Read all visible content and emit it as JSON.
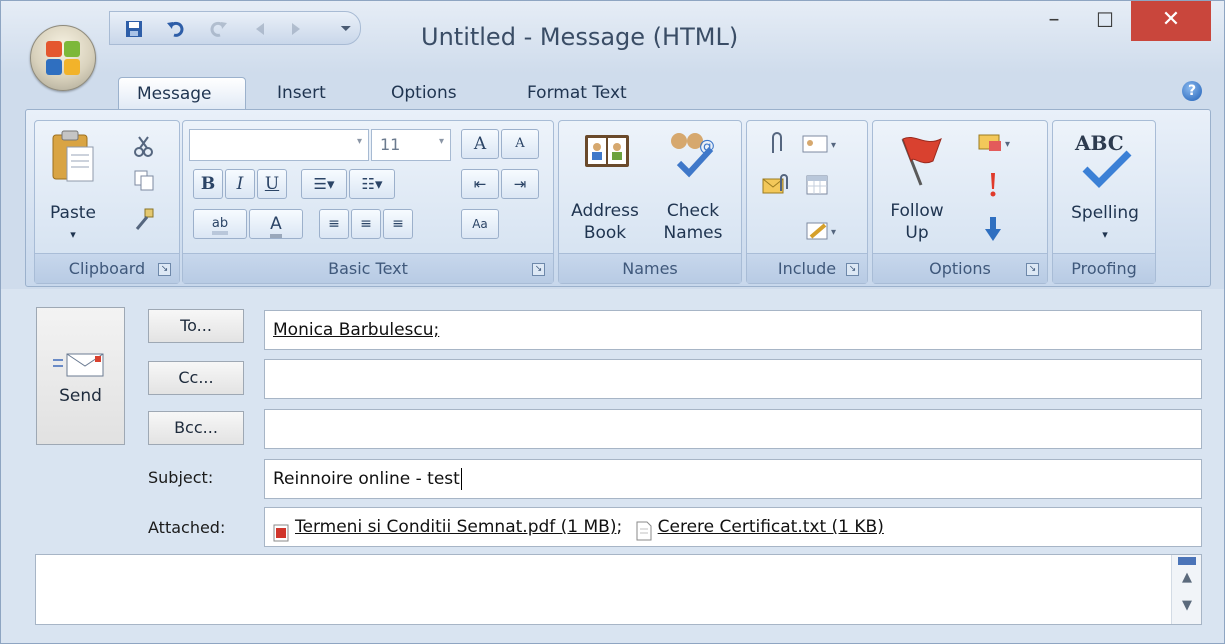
{
  "window": {
    "title": "Untitled - Message (HTML)",
    "controls": {
      "minimize": "–",
      "maximize": "☐",
      "close": "✕"
    }
  },
  "qat": {
    "items": [
      "save-icon",
      "undo-icon",
      "redo-icon",
      "previous-icon",
      "next-icon",
      "customize-icon"
    ]
  },
  "tabs": [
    {
      "label": "Message",
      "active": true
    },
    {
      "label": "Insert",
      "active": false
    },
    {
      "label": "Options",
      "active": false
    },
    {
      "label": "Format Text",
      "active": false
    }
  ],
  "ribbon": {
    "clipboard": {
      "label": "Clipboard",
      "paste_label": "Paste"
    },
    "basic_text": {
      "label": "Basic Text",
      "font_name": "",
      "font_size": "11",
      "bold": "B",
      "italic": "I",
      "underline": "U",
      "grow": "A",
      "shrink": "A",
      "highlight": "ab",
      "font_color": "A"
    },
    "names": {
      "label": "Names",
      "address_book_line1": "Address",
      "address_book_line2": "Book",
      "check_names_line1": "Check",
      "check_names_line2": "Names"
    },
    "include": {
      "label": "Include"
    },
    "options": {
      "label": "Options",
      "follow_up_line1": "Follow",
      "follow_up_line2": "Up"
    },
    "proofing": {
      "label": "Proofing",
      "spelling_label": "Spelling",
      "abc": "ABC"
    }
  },
  "form": {
    "send_label": "Send",
    "to_button": "To...",
    "cc_button": "Cc...",
    "bcc_button": "Bcc...",
    "to_value": "Monica Barbulescu;",
    "cc_value": "",
    "bcc_value": "",
    "subject_label": "Subject:",
    "subject_value": "Reinnoire online - test",
    "attached_label": "Attached:",
    "attachments": [
      {
        "name": "Termeni si Conditii Semnat.pdf (1 MB)",
        "separator": ";",
        "icon": "pdf-icon"
      },
      {
        "name": "Cerere Certificat.txt (1 KB)",
        "separator": "",
        "icon": "text-file-icon"
      }
    ]
  },
  "colors": {
    "accent": "#1f5fb6",
    "close": "#c9463c",
    "ribbon": "#d2e0f0"
  }
}
